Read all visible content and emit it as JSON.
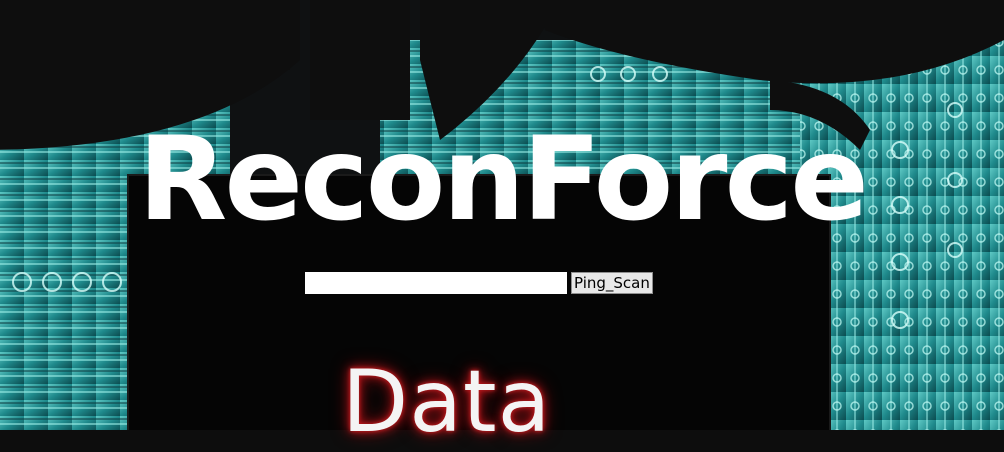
{
  "page": {
    "title": "ReconForce",
    "subtitle": "Data"
  },
  "scan_form": {
    "target_input_value": "",
    "target_input_placeholder": "",
    "button_label": "Ping_Scan"
  },
  "colors": {
    "teal_circuit": "#2a9a9a",
    "circuit_highlight": "#8fe3df",
    "dark_panel": "#050505",
    "title_text": "#ffffff",
    "subtitle_glow": "#c0151b"
  },
  "background": {
    "image_description": "circuit-board-icon"
  }
}
